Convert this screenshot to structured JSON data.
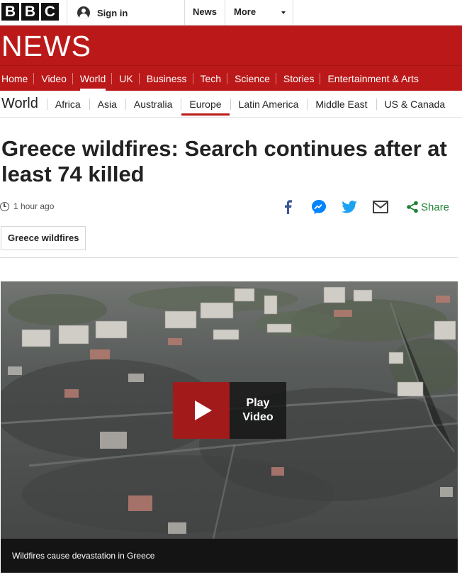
{
  "brand": {
    "letters": [
      "B",
      "B",
      "C"
    ]
  },
  "topbar": {
    "signin_label": "Sign in",
    "news_label": "News",
    "more_label": "More"
  },
  "banner": {
    "title": "NEWS"
  },
  "main_nav": [
    {
      "label": "Home"
    },
    {
      "label": "Video"
    },
    {
      "label": "World"
    },
    {
      "label": "UK"
    },
    {
      "label": "Business"
    },
    {
      "label": "Tech"
    },
    {
      "label": "Science"
    },
    {
      "label": "Stories"
    },
    {
      "label": "Entertainment & Arts"
    }
  ],
  "main_nav_active": "World",
  "section": {
    "title": "World",
    "items": [
      {
        "label": "Africa"
      },
      {
        "label": "Asia"
      },
      {
        "label": "Australia"
      },
      {
        "label": "Europe"
      },
      {
        "label": "Latin America"
      },
      {
        "label": "Middle East"
      },
      {
        "label": "US & Canada"
      }
    ],
    "active": "Europe"
  },
  "article": {
    "headline": "Greece wildfires: Search continues after at least 74 killed",
    "timestamp": "1 hour ago",
    "share_label": "Share",
    "tag": "Greece wildfires"
  },
  "video": {
    "play_label_1": "Play",
    "play_label_2": "Video",
    "caption": "Wildfires cause devastation in Greece"
  },
  "colors": {
    "brand_red": "#bb1919",
    "facebook": "#3b5998",
    "messenger": "#0084ff",
    "twitter": "#1da1f2",
    "share_green": "#208033"
  },
  "icons": {
    "share": [
      "facebook-icon",
      "messenger-icon",
      "twitter-icon",
      "email-icon",
      "share-icon"
    ]
  }
}
